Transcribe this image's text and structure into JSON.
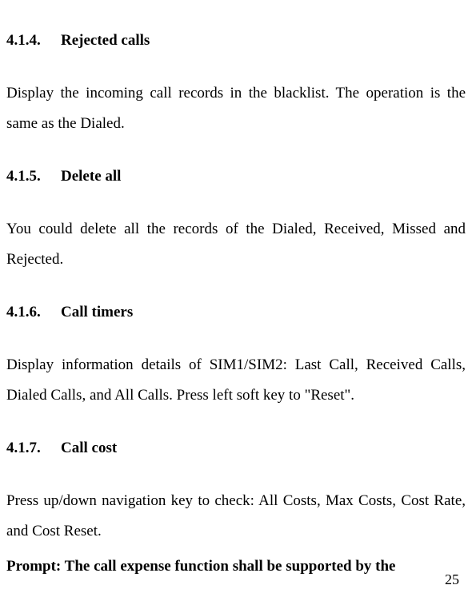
{
  "sections": {
    "s1": {
      "number": "4.1.4.",
      "title": "Rejected calls",
      "body": "Display the incoming call records in the blacklist. The operation is the same as the Dialed."
    },
    "s2": {
      "number": "4.1.5.",
      "title": "Delete all",
      "body": "You could delete all the records of the Dialed, Received, Missed and Rejected."
    },
    "s3": {
      "number": "4.1.6.",
      "title": "Call timers",
      "body": "Display information details of SIM1/SIM2: Last Call, Received Calls, Dialed Calls, and All Calls. Press left soft key to \"Reset\"."
    },
    "s4": {
      "number": "4.1.7.",
      "title": "Call cost",
      "body": "Press up/down navigation key to check: All Costs, Max Costs, Cost Rate, and Cost Reset."
    }
  },
  "prompt": "Prompt: The call expense function shall be supported by the",
  "pageNumber": "25"
}
